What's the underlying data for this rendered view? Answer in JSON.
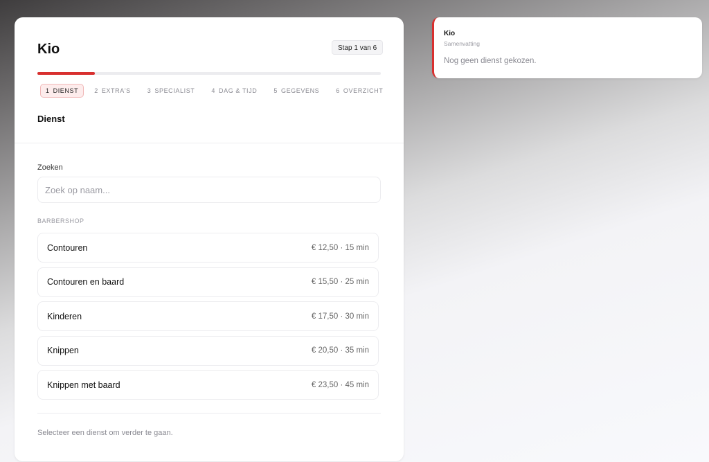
{
  "brand": {
    "name": "Kio"
  },
  "stepper": {
    "badge": "Stap 1 van 6",
    "progress": 0.1667,
    "accent_color": "#d8302f",
    "steps": [
      {
        "num": "1",
        "label": "Dienst",
        "active": true
      },
      {
        "num": "2",
        "label": "Extra's",
        "active": false
      },
      {
        "num": "3",
        "label": "Specialist",
        "active": false
      },
      {
        "num": "4",
        "label": "Dag & tijd",
        "active": false
      },
      {
        "num": "5",
        "label": "Gegevens",
        "active": false
      },
      {
        "num": "6",
        "label": "Overzicht",
        "active": false
      }
    ]
  },
  "section": {
    "title": "Dienst"
  },
  "search": {
    "label": "Zoeken",
    "placeholder": "Zoek op naam...",
    "value": ""
  },
  "services": {
    "group_label": "Barbershop",
    "items": [
      {
        "name": "Contouren",
        "meta": "€ 12,50 · 15 min"
      },
      {
        "name": "Contouren en baard",
        "meta": "€ 15,50 · 25 min"
      },
      {
        "name": "Kinderen",
        "meta": "€ 17,50 · 30 min"
      },
      {
        "name": "Knippen",
        "meta": "€ 20,50 · 35 min"
      },
      {
        "name": "Knippen met baard",
        "meta": "€ 23,50 · 45 min"
      }
    ]
  },
  "footer": {
    "hint": "Selecteer een dienst om verder te gaan."
  },
  "summary": {
    "brand": "Kio",
    "subtitle": "Samenvatting",
    "empty_text": "Nog geen dienst gekozen."
  }
}
